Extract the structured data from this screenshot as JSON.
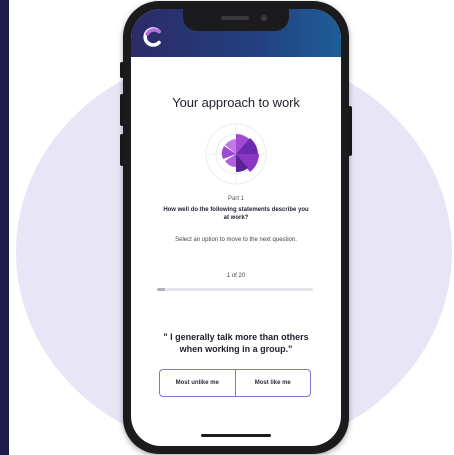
{
  "app": {
    "logo_icon": "crescent-logo-icon",
    "header_colors": [
      "#2c2b67",
      "#1d5d99"
    ],
    "accent_color": "#7d3cc8"
  },
  "assessment": {
    "title": "Your approach to work",
    "part_label": "Part 1",
    "question_prompt": "How well do the following statements describe you at work?",
    "instruction": "Select an option to move to the next question.",
    "progress": {
      "label": "1 of 20",
      "current": 1,
      "total": 20
    },
    "statement": "\" I generally talk more than others when working in a group.\"",
    "answers": [
      {
        "label": "Most unlike me"
      },
      {
        "label": "Most like me"
      }
    ]
  }
}
